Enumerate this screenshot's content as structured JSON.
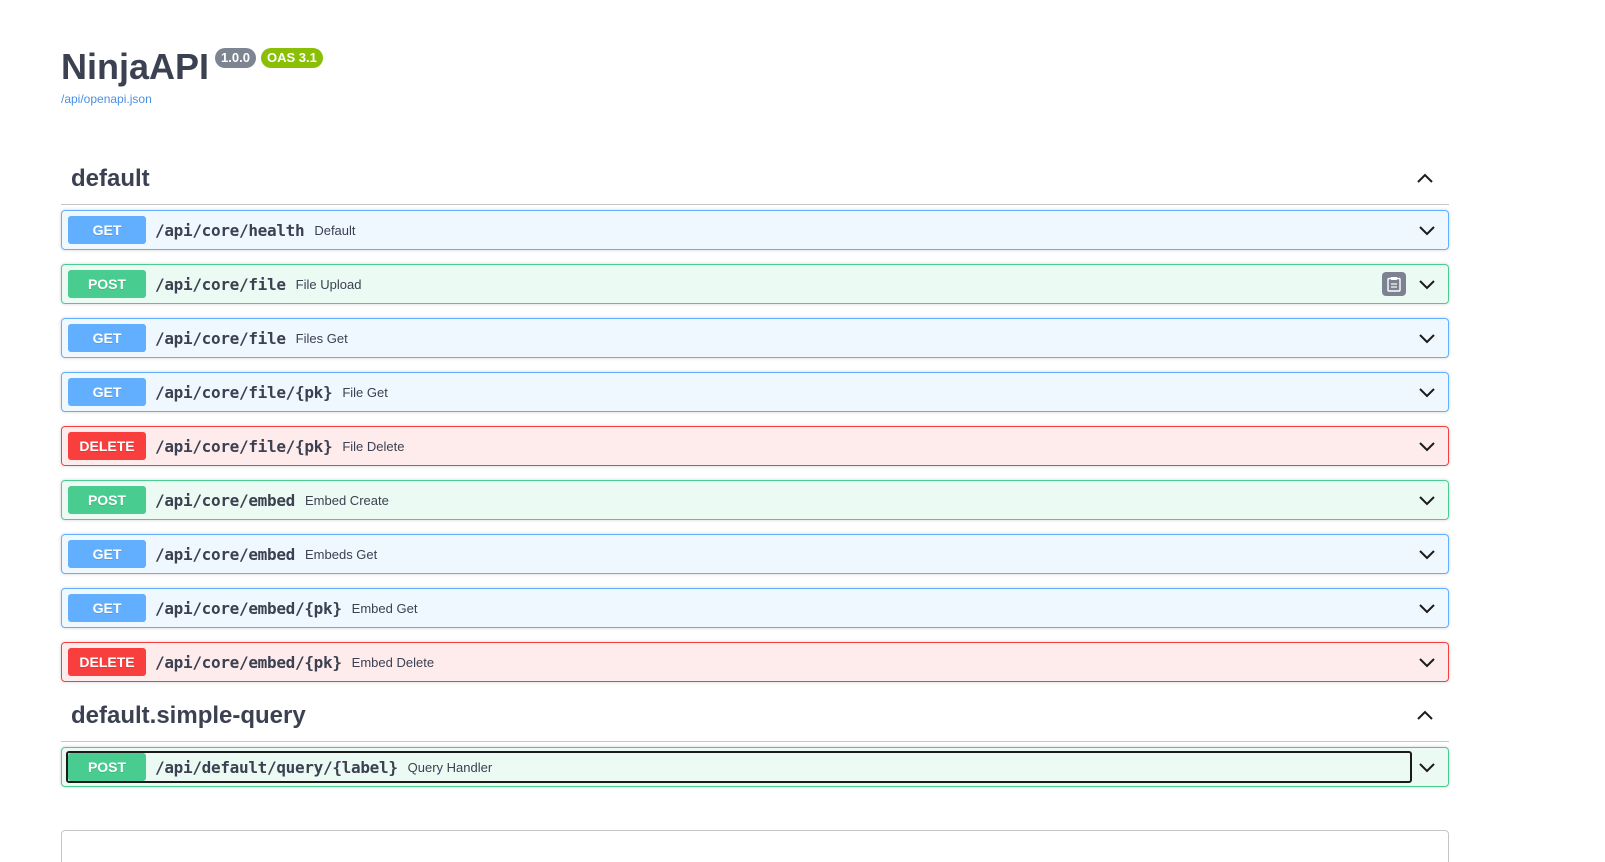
{
  "info": {
    "title": "NinjaAPI",
    "version": "1.0.0",
    "oas": "OAS 3.1",
    "spec_url": "/api/openapi.json"
  },
  "tags": [
    {
      "name": "default",
      "operations": [
        {
          "method": "GET",
          "path": "/api/core/health",
          "summary": "Default"
        },
        {
          "method": "POST",
          "path": "/api/core/file",
          "summary": "File Upload"
        },
        {
          "method": "GET",
          "path": "/api/core/file",
          "summary": "Files Get"
        },
        {
          "method": "GET",
          "path": "/api/core/file/{pk}",
          "summary": "File Get"
        },
        {
          "method": "DELETE",
          "path": "/api/core/file/{pk}",
          "summary": "File Delete"
        },
        {
          "method": "POST",
          "path": "/api/core/embed",
          "summary": "Embed Create"
        },
        {
          "method": "GET",
          "path": "/api/core/embed",
          "summary": "Embeds Get"
        },
        {
          "method": "GET",
          "path": "/api/core/embed/{pk}",
          "summary": "Embed Get"
        },
        {
          "method": "DELETE",
          "path": "/api/core/embed/{pk}",
          "summary": "Embed Delete"
        }
      ]
    },
    {
      "name": "default.simple-query",
      "operations": [
        {
          "method": "POST",
          "path": "/api/default/query/{label}",
          "summary": "Query Handler"
        }
      ]
    }
  ],
  "icons": {
    "tag_toggle": "chevron-up-icon",
    "op_toggle": "chevron-down-icon",
    "copy": "clipboard-icon"
  },
  "colors": {
    "get": "#61affe",
    "post": "#49cc90",
    "delete": "#f93e3e",
    "version_badge": "#7d8492",
    "oas_badge": "#89bf04",
    "link": "#4990e2"
  }
}
